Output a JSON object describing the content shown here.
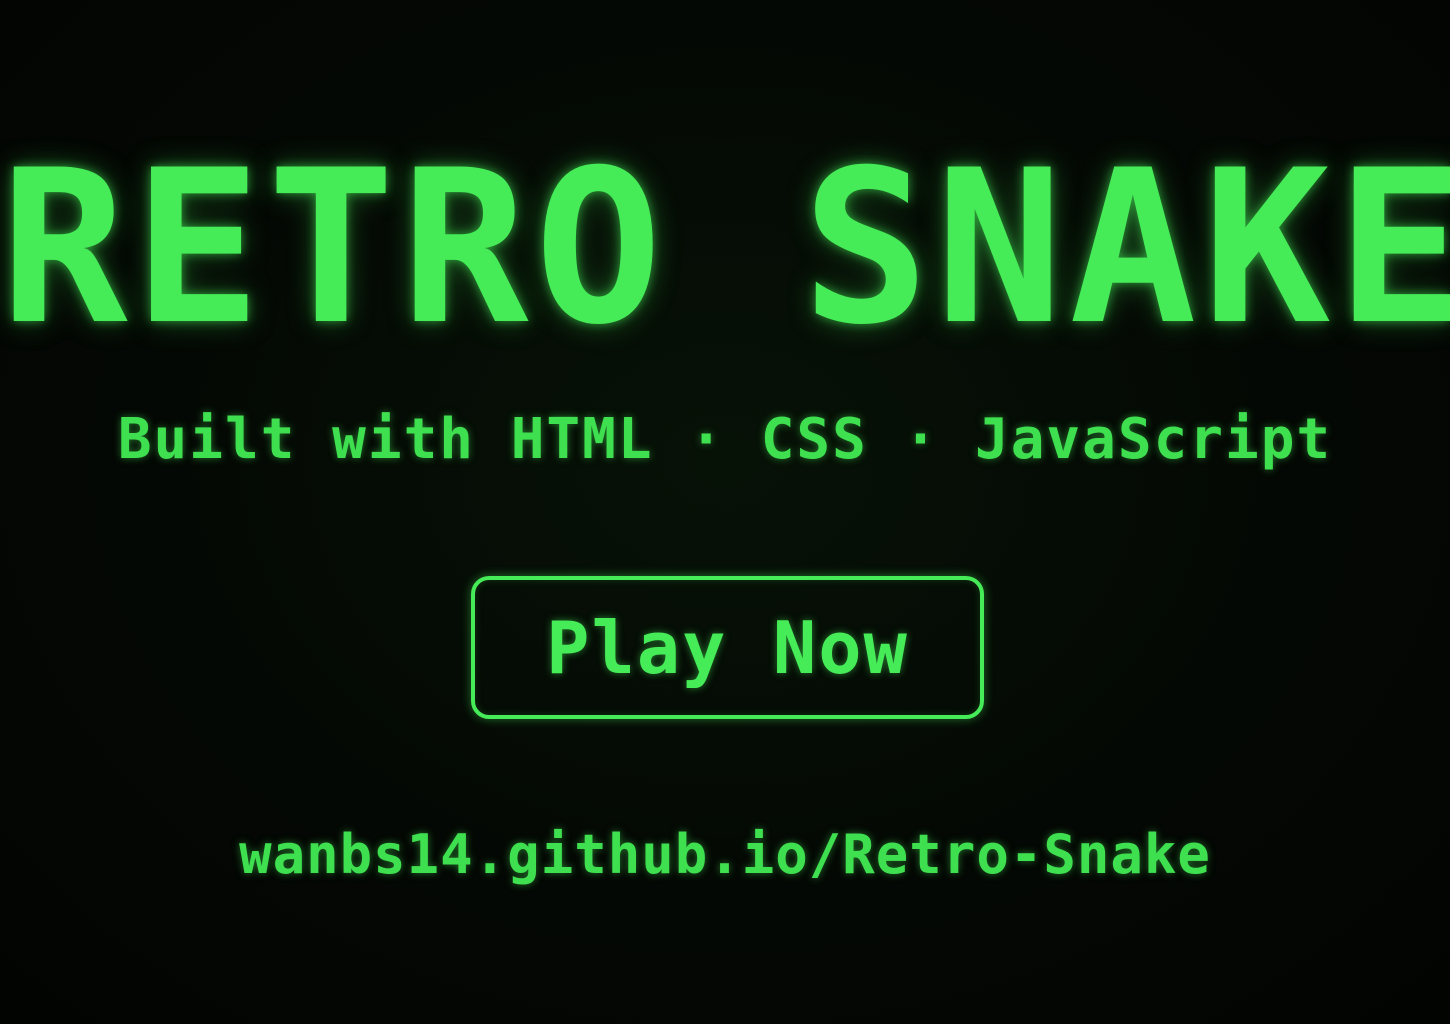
{
  "title": "RETRO SNAKE",
  "subtitle": "Built with HTML · CSS · JavaScript",
  "play_button": {
    "label": "Play Now"
  },
  "link": {
    "text": "wanbs14.github.io/Retro-Snake"
  },
  "colors": {
    "accent": "#45ec57",
    "background": "#030703"
  }
}
